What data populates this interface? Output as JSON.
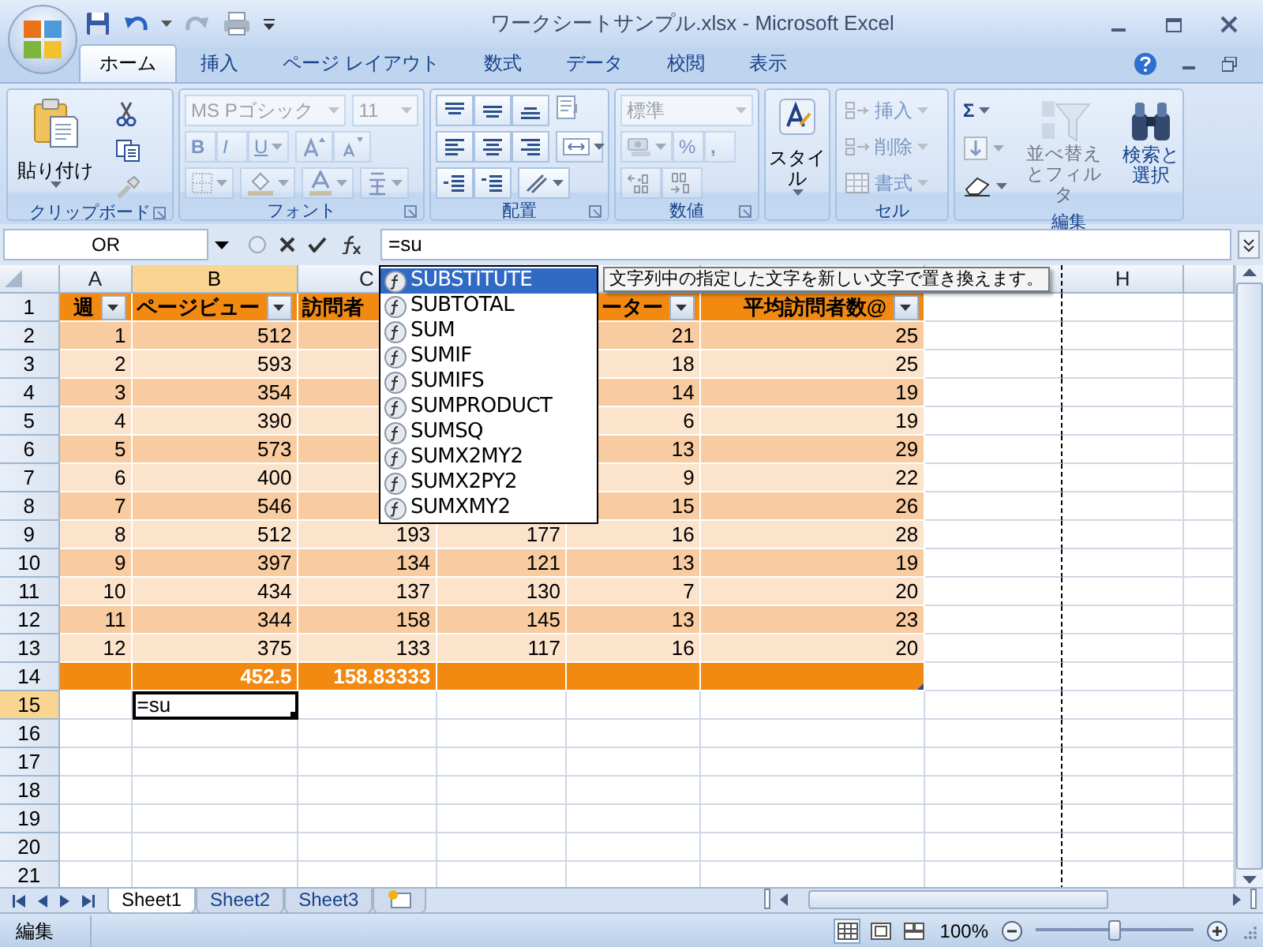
{
  "window": {
    "title": "ワークシートサンプル.xlsx - Microsoft Excel"
  },
  "ribbon_tabs": [
    {
      "label": "ホーム",
      "selected": true
    },
    {
      "label": "挿入",
      "selected": false
    },
    {
      "label": "ページ レイアウト",
      "selected": false
    },
    {
      "label": "数式",
      "selected": false
    },
    {
      "label": "データ",
      "selected": false
    },
    {
      "label": "校閲",
      "selected": false
    },
    {
      "label": "表示",
      "selected": false
    }
  ],
  "ribbon": [
    {
      "kind": "clipboard",
      "label": "クリップボード",
      "disabled": false,
      "paste": "貼り付け"
    },
    {
      "kind": "font",
      "label": "フォント",
      "disabled": true,
      "font_name": "MS Pゴシック",
      "font_size": "11",
      "bold": "B",
      "italic": "I",
      "underline": "U"
    },
    {
      "kind": "alignment",
      "label": "配置",
      "disabled": false
    },
    {
      "kind": "number",
      "label": "数値",
      "disabled": true,
      "format": "標準",
      "percent": "%",
      "comma": ","
    },
    {
      "kind": "styles",
      "disabled": false,
      "button": "スタイル"
    },
    {
      "kind": "cells",
      "label": "セル",
      "disabled": true,
      "buttons": [
        "挿入",
        "削除",
        "書式"
      ]
    },
    {
      "kind": "editing",
      "label": "編集",
      "disabled": false,
      "sum": "Σ",
      "sort": {
        "label": "並べ替えとフィルタ",
        "disabled": true
      },
      "find": {
        "label": "検索と選択",
        "disabled": false
      }
    }
  ],
  "formula_bar": {
    "name_box": "OR",
    "formula": "=su"
  },
  "column_headers": [
    {
      "label": "A",
      "selected": false
    },
    {
      "label": "B",
      "selected": true
    },
    {
      "label": "C",
      "selected": false
    },
    {
      "label": "H",
      "selected": false
    }
  ],
  "row_headers": [
    {
      "label": "1",
      "selected": false
    },
    {
      "label": "2",
      "selected": false
    },
    {
      "label": "3",
      "selected": false
    },
    {
      "label": "4",
      "selected": false
    },
    {
      "label": "5",
      "selected": false
    },
    {
      "label": "6",
      "selected": false
    },
    {
      "label": "7",
      "selected": false
    },
    {
      "label": "8",
      "selected": false
    },
    {
      "label": "9",
      "selected": false
    },
    {
      "label": "10",
      "selected": false
    },
    {
      "label": "11",
      "selected": false
    },
    {
      "label": "12",
      "selected": false
    },
    {
      "label": "13",
      "selected": false
    },
    {
      "label": "14",
      "selected": false
    },
    {
      "label": "15",
      "selected": true
    },
    {
      "label": "16",
      "selected": false
    },
    {
      "label": "17",
      "selected": false
    },
    {
      "label": "18",
      "selected": false
    },
    {
      "label": "19",
      "selected": false
    },
    {
      "label": "20",
      "selected": false
    },
    {
      "label": "21",
      "selected": false
    }
  ],
  "rows": [
    {
      "kind": "header",
      "cells": [
        {
          "text": "週",
          "filter": true
        },
        {
          "text": "ページビュー",
          "filter": true
        },
        {
          "text": "訪問者",
          "filter": false
        },
        null,
        {
          "text": "ーター",
          "filter": true
        },
        {
          "text": "平均訪問者数@",
          "filter": true
        }
      ]
    },
    {
      "kind": "data",
      "cells": [
        "1",
        "512",
        null,
        null,
        "21",
        "25"
      ]
    },
    {
      "kind": "data",
      "cells": [
        "2",
        "593",
        null,
        null,
        "18",
        "25"
      ]
    },
    {
      "kind": "data",
      "cells": [
        "3",
        "354",
        null,
        null,
        "14",
        "19"
      ]
    },
    {
      "kind": "data",
      "cells": [
        "4",
        "390",
        null,
        null,
        "6",
        "19"
      ]
    },
    {
      "kind": "data",
      "cells": [
        "5",
        "573",
        null,
        null,
        "13",
        "29"
      ]
    },
    {
      "kind": "data",
      "cells": [
        "6",
        "400",
        null,
        null,
        "9",
        "22"
      ]
    },
    {
      "kind": "data",
      "cells": [
        "7",
        "546",
        null,
        null,
        "15",
        "26"
      ]
    },
    {
      "kind": "data",
      "cells": [
        "8",
        "512",
        "193",
        "177",
        "16",
        "28"
      ]
    },
    {
      "kind": "data",
      "cells": [
        "9",
        "397",
        "134",
        "121",
        "13",
        "19"
      ]
    },
    {
      "kind": "data",
      "cells": [
        "10",
        "434",
        "137",
        "130",
        "7",
        "20"
      ]
    },
    {
      "kind": "data",
      "cells": [
        "11",
        "344",
        "158",
        "145",
        "13",
        "23"
      ]
    },
    {
      "kind": "data",
      "cells": [
        "12",
        "375",
        "133",
        "117",
        "16",
        "20"
      ]
    },
    {
      "kind": "total",
      "cells": [
        null,
        "452.5",
        "158.83333",
        null,
        null,
        null
      ]
    },
    {
      "kind": "editing",
      "cells": [
        null,
        "=su",
        null,
        null,
        null,
        null
      ]
    }
  ],
  "autocomplete": {
    "items": [
      {
        "label": "SUBSTITUTE",
        "selected": true
      },
      {
        "label": "SUBTOTAL",
        "selected": false
      },
      {
        "label": "SUM",
        "selected": false
      },
      {
        "label": "SUMIF",
        "selected": false
      },
      {
        "label": "SUMIFS",
        "selected": false
      },
      {
        "label": "SUMPRODUCT",
        "selected": false
      },
      {
        "label": "SUMSQ",
        "selected": false
      },
      {
        "label": "SUMX2MY2",
        "selected": false
      },
      {
        "label": "SUMX2PY2",
        "selected": false
      },
      {
        "label": "SUMXMY2",
        "selected": false
      }
    ],
    "tooltip": "文字列中の指定した文字を新しい文字で置き換えます。"
  },
  "sheet_tabs": [
    {
      "label": "Sheet1",
      "selected": true
    },
    {
      "label": "Sheet2",
      "selected": false
    },
    {
      "label": "Sheet3",
      "selected": false
    }
  ],
  "status_bar": {
    "mode": "編集",
    "views": [
      {
        "kind": "normal",
        "selected": true
      },
      {
        "kind": "page_layout",
        "selected": false
      },
      {
        "kind": "page_break",
        "selected": false
      }
    ],
    "zoom": "100%",
    "zoom_slider": {
      "level": 0.5
    }
  }
}
